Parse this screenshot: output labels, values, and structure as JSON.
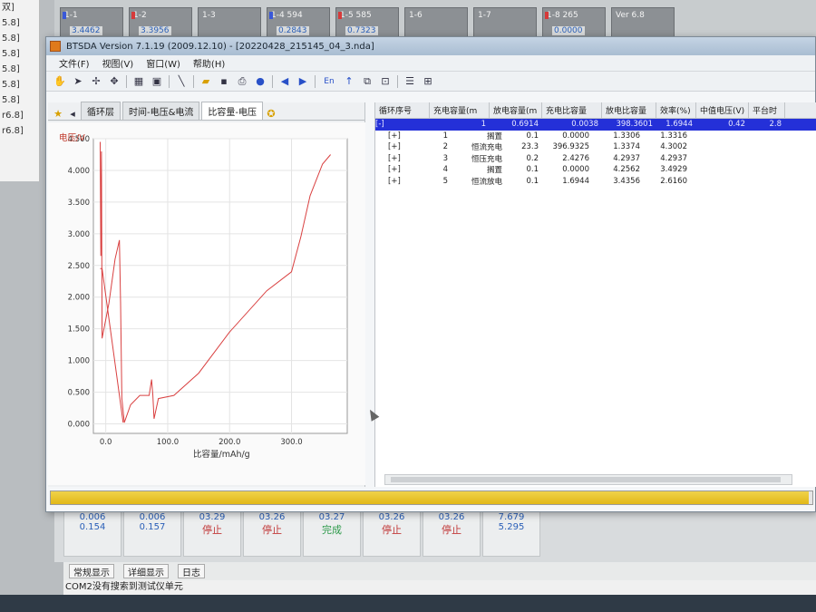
{
  "background": {
    "left_items": [
      "双]",
      "5.8]",
      "5.8]",
      "5.8]",
      "5.8]",
      "5.8]",
      "5.8]",
      "r6.8]",
      "r6.8]"
    ],
    "channels": [
      {
        "name": "1-1",
        "value": "3.4462",
        "flag": "blue"
      },
      {
        "name": "1-2",
        "value": "3.3956",
        "flag": "red"
      },
      {
        "name": "1-3",
        "value": "",
        "flag": "none"
      },
      {
        "name": "1-4 594",
        "value": "0.2843",
        "flag": "blue"
      },
      {
        "name": "1-5 585",
        "value": "0.7323",
        "flag": "red"
      },
      {
        "name": "1-6",
        "value": "",
        "flag": "none"
      },
      {
        "name": "1-7",
        "value": "",
        "flag": "none"
      },
      {
        "name": "1-8 265",
        "value": "0.0000",
        "flag": "red"
      },
      {
        "name": "Ver 6.8",
        "value": "",
        "flag": "none"
      }
    ],
    "cells": [
      {
        "a": "0.006",
        "b": "0.154",
        "s": ""
      },
      {
        "a": "0.006",
        "b": "0.157",
        "s": ""
      },
      {
        "a": "03.29",
        "b": "",
        "s": "停止"
      },
      {
        "a": "03.26",
        "b": "",
        "s": "停止"
      },
      {
        "a": "03.27",
        "b": "",
        "s": "完成"
      },
      {
        "a": "03.26",
        "b": "",
        "s": "停止"
      },
      {
        "a": "03.26",
        "b": "",
        "s": "停止"
      },
      {
        "a": "7.679",
        "b": "5.295",
        "s": ""
      }
    ],
    "tabs": [
      "常规显示",
      "详细显示",
      "日志"
    ],
    "status": "COM2没有搜索到测试仪单元"
  },
  "window": {
    "title": "BTSDA Version 7.1.19 (2009.12.10)  - [20220428_215145_04_3.nda]",
    "menu": [
      "文件(F)",
      "视图(V)",
      "窗口(W)",
      "帮助(H)"
    ],
    "toolbar_text": "En"
  },
  "left_tabs": [
    "循环层",
    "时间-电压&电流",
    "比容量-电压"
  ],
  "chart_data": {
    "type": "line",
    "ylabel": "电压/V",
    "xlabel": "比容量/mAh/g",
    "xlim": [
      -20,
      390
    ],
    "ylim": [
      -0.15,
      4.5
    ],
    "yticks": [
      "4.500",
      "4.000",
      "3.500",
      "3.000",
      "2.500",
      "2.000",
      "1.500",
      "1.000",
      "0.500",
      "0.000"
    ],
    "xticks": [
      "0.0",
      "100.0",
      "200.0",
      "300.0"
    ],
    "series": [
      {
        "color": "#d94040",
        "points": [
          [
            -9,
            4.45
          ],
          [
            -8,
            2.65
          ],
          [
            -7,
            4.3
          ],
          [
            -6,
            1.35
          ],
          [
            5,
            1.9
          ],
          [
            15,
            2.6
          ],
          [
            22,
            2.9
          ],
          [
            24,
            1.9
          ],
          [
            26,
            0.4
          ],
          [
            30,
            0.02
          ],
          [
            40,
            0.3
          ],
          [
            55,
            0.45
          ],
          [
            70,
            0.45
          ],
          [
            74,
            0.7
          ],
          [
            76,
            0.45
          ],
          [
            78,
            0.08
          ],
          [
            85,
            0.4
          ],
          [
            110,
            0.45
          ],
          [
            150,
            0.8
          ],
          [
            200,
            1.45
          ],
          [
            260,
            2.1
          ],
          [
            300,
            2.4
          ],
          [
            315,
            2.95
          ],
          [
            330,
            3.6
          ],
          [
            350,
            4.1
          ],
          [
            363,
            4.25
          ]
        ]
      },
      {
        "color": "#d94040",
        "points": [
          [
            -9,
            2.45
          ],
          [
            -6,
            2.45
          ],
          [
            28,
            0.02
          ]
        ]
      }
    ]
  },
  "table": {
    "headers": [
      "循环序号",
      "充电容量(m",
      "放电容量(m",
      "充电比容量",
      "放电比容量",
      "效率(%)",
      "中值电压(V)",
      "平台时"
    ],
    "summary": [
      "[-]",
      "1",
      "0.6914",
      "0.0038",
      "398.3601",
      "1.6944",
      "0.42",
      "2.8"
    ],
    "rows": [
      [
        "[+]",
        "1",
        "搁置",
        "0.1",
        "0.0000",
        "1.3306",
        "1.3316"
      ],
      [
        "[+]",
        "2",
        "恒流充电",
        "23.3",
        "396.9325",
        "1.3374",
        "4.3002"
      ],
      [
        "[+]",
        "3",
        "恒压充电",
        "0.2",
        "2.4276",
        "4.2937",
        "4.2937"
      ],
      [
        "[+]",
        "4",
        "搁置",
        "0.1",
        "0.0000",
        "4.2562",
        "3.4929"
      ],
      [
        "[+]",
        "5",
        "恒流放电",
        "0.1",
        "1.6944",
        "3.4356",
        "2.6160"
      ]
    ]
  },
  "progress": {
    "fraction": 0.995,
    "color": "#e2b818"
  }
}
